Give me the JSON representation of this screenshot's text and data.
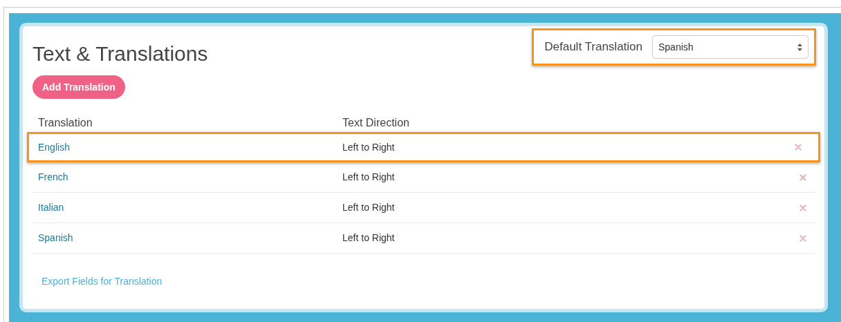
{
  "title": "Text & Translations",
  "default_translation": {
    "label": "Default Translation",
    "value": "Spanish",
    "highlighted": true
  },
  "add_button": "Add Translation",
  "table": {
    "columns": [
      "Translation",
      "Text Direction"
    ],
    "rows": [
      {
        "translation": "English",
        "direction": "Left to Right",
        "highlighted": true
      },
      {
        "translation": "French",
        "direction": "Left to Right",
        "highlighted": false
      },
      {
        "translation": "Italian",
        "direction": "Left to Right",
        "highlighted": false
      },
      {
        "translation": "Spanish",
        "direction": "Left to Right",
        "highlighted": false
      }
    ]
  },
  "export_link": "Export Fields for Translation"
}
